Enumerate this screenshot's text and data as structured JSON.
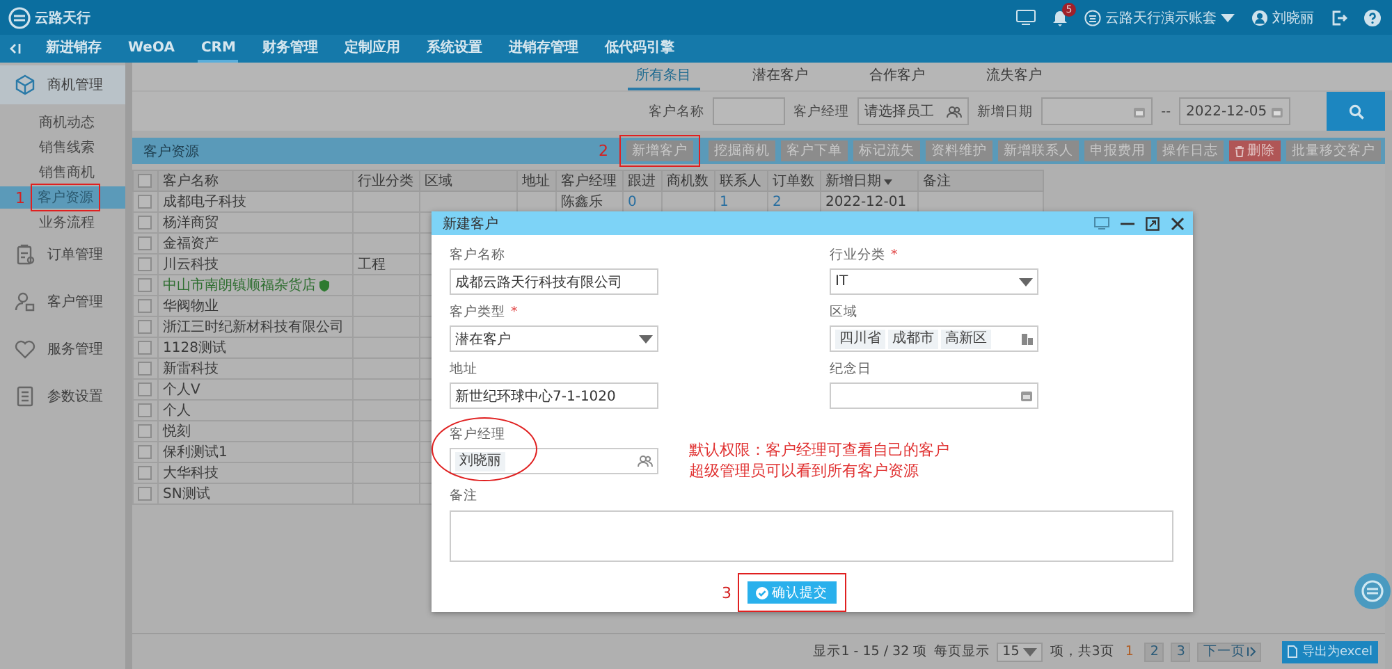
{
  "topbar": {
    "logo_text": "云路天行",
    "notification_count": "5",
    "account": "云路天行演示账套",
    "user": "刘晓丽"
  },
  "nav": [
    {
      "label": "新进销存",
      "selected": false
    },
    {
      "label": "WeOA",
      "selected": false
    },
    {
      "label": "CRM",
      "selected": true
    },
    {
      "label": "财务管理",
      "selected": false
    },
    {
      "label": "定制应用",
      "selected": false
    },
    {
      "label": "系统设置",
      "selected": false
    },
    {
      "label": "进销存管理",
      "selected": false
    },
    {
      "label": "低代码引擎",
      "selected": false
    }
  ],
  "sidebar": [
    {
      "label": "商机管理",
      "expanded": true,
      "children": [
        {
          "label": "商机动态",
          "selected": false
        },
        {
          "label": "销售线索",
          "selected": false
        },
        {
          "label": "销售商机",
          "selected": false
        },
        {
          "label": "客户资源",
          "selected": true
        },
        {
          "label": "业务流程",
          "selected": false
        }
      ]
    },
    {
      "label": "订单管理",
      "expanded": false
    },
    {
      "label": "客户管理",
      "expanded": false
    },
    {
      "label": "服务管理",
      "expanded": false
    },
    {
      "label": "参数设置",
      "expanded": false
    }
  ],
  "tabs": [
    {
      "label": "所有条目",
      "selected": true
    },
    {
      "label": "潜在客户",
      "selected": false
    },
    {
      "label": "合作客户",
      "selected": false
    },
    {
      "label": "流失客户",
      "selected": false
    }
  ],
  "filters": {
    "name_label": "客户名称",
    "manager_label": "客户经理",
    "manager_placeholder": "请选择员工",
    "date_label": "新增日期",
    "date_separator": "--",
    "date_end": "2022-12-05"
  },
  "grid": {
    "title": "客户资源",
    "buttons": [
      {
        "label": "新增客户",
        "kind": "normal"
      },
      {
        "label": "挖掘商机",
        "kind": "normal"
      },
      {
        "label": "客户下单",
        "kind": "normal"
      },
      {
        "label": "标记流失",
        "kind": "normal"
      },
      {
        "label": "资料维护",
        "kind": "normal"
      },
      {
        "label": "新增联系人",
        "kind": "normal"
      },
      {
        "label": "申报费用",
        "kind": "normal"
      },
      {
        "label": "操作日志",
        "kind": "normal"
      },
      {
        "label": "删除",
        "kind": "danger"
      },
      {
        "label": "批量移交客户",
        "kind": "normal"
      }
    ],
    "columns": [
      "客户名称",
      "行业分类",
      "区域",
      "地址",
      "客户经理",
      "跟进",
      "商机数",
      "联系人",
      "订单数",
      "新增日期",
      "备注"
    ],
    "header_checked": false,
    "rows": [
      {
        "checked": false,
        "name": "成都电子科技",
        "verified": false,
        "manager": "陈鑫乐",
        "follow": "0",
        "contacts": "1",
        "orders": "2",
        "date": "2022-12-01"
      },
      {
        "checked": false,
        "name": "杨洋商贸",
        "verified": false
      },
      {
        "checked": false,
        "name": "金福资产",
        "verified": false
      },
      {
        "checked": false,
        "name": "川云科技",
        "verified": false,
        "industry": "工程"
      },
      {
        "checked": false,
        "name": "中山市南朗镇顺福杂货店",
        "verified": true
      },
      {
        "checked": false,
        "name": "华阀物业",
        "verified": false
      },
      {
        "checked": false,
        "name": "浙江三时纪新材科技有限公司",
        "verified": false
      },
      {
        "checked": false,
        "name": "1128测试",
        "verified": false
      },
      {
        "checked": false,
        "name": "新雷科技",
        "verified": false
      },
      {
        "checked": false,
        "name": "个人V",
        "verified": false
      },
      {
        "checked": false,
        "name": "个人",
        "verified": false
      },
      {
        "checked": false,
        "name": "悦刻",
        "verified": false
      },
      {
        "checked": false,
        "name": "保利测试1",
        "verified": false
      },
      {
        "checked": false,
        "name": "大华科技",
        "verified": false
      },
      {
        "checked": false,
        "name": "SN测试",
        "verified": false
      }
    ]
  },
  "pagination": {
    "summary": "显示1 - 15 / 32 项",
    "per_page_label": "每页显示",
    "per_page": "15",
    "pages_label": "项，共3页",
    "pages": [
      {
        "label": "1",
        "selected": true
      },
      {
        "label": "2",
        "selected": false
      },
      {
        "label": "3",
        "selected": false
      }
    ],
    "next": "下一页",
    "export": "导出为excel"
  },
  "dialog": {
    "title": "新建客户",
    "name": {
      "label": "客户名称",
      "value": "成都云路天行科技有限公司"
    },
    "industry": {
      "label": "行业分类",
      "required": true,
      "value": "IT"
    },
    "type": {
      "label": "客户类型",
      "required": true,
      "value": "潜在客户"
    },
    "region": {
      "label": "区域",
      "chips": [
        "四川省",
        "成都市",
        "高新区"
      ]
    },
    "address": {
      "label": "地址",
      "value": "新世纪环球中心7-1-1020"
    },
    "anniversary": {
      "label": "纪念日"
    },
    "manager": {
      "label": "客户经理",
      "chip": "刘晓丽"
    },
    "notes": {
      "label": "备注"
    },
    "required_mark": "*",
    "submit": "确认提交"
  },
  "annotations": {
    "step_1": "1",
    "step_2": "2",
    "step_3": "3",
    "note": [
      "默认权限：客户经理可查看自己的客户",
      "超级管理员可以看到所有客户资源"
    ]
  }
}
